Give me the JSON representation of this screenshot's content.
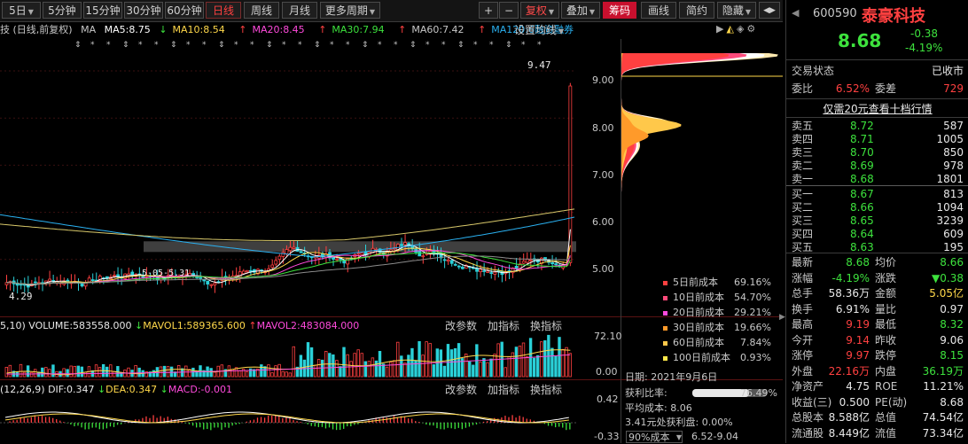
{
  "toolbar": {
    "periods": [
      "5日",
      "5分钟",
      "15分钟",
      "30分钟",
      "60分钟",
      "日线",
      "周线",
      "月线",
      "更多周期"
    ],
    "active_period": "日线",
    "plus": "+",
    "minus": "−",
    "fuquan": "复权",
    "diejia": "叠加",
    "chouma": "筹码",
    "huaxian": "画线",
    "jianyue": "简约",
    "yincang": "隐藏",
    "nav_left": "◀",
    "nav_right": "▶"
  },
  "ma_legend": {
    "prefix": "技 (日线,前复权)",
    "ma": "MA",
    "ma5": "MA5:8.75",
    "ma10": "MA10:8.54",
    "ma20": "MA20:8.45",
    "ma30": "MA30:7.94",
    "ma60": "MA60:7.42",
    "ma120": "MA120:6融资融券",
    "settings": "设置均线"
  },
  "colors": {
    "ma5": "#ffffff",
    "ma10": "#ffd84a",
    "ma20": "#ff4adc",
    "ma30": "#3de23d",
    "ma60": "#8c8c8c",
    "ma120": "#2ab0f0",
    "up": "#ff4040",
    "down": "#2ad0d8"
  },
  "price_axis": [
    "9.00",
    "8.00",
    "7.00",
    "6.00",
    "5.00"
  ],
  "annotations": {
    "high": "9.47",
    "low": "4.29",
    "label_left": "5-05-5.31"
  },
  "volume": {
    "label": "5,10)  VOLUME:583558.000",
    "mavol1": "MAVOL1:589365.600",
    "mavol2": "MAVOL2:483084.000",
    "btn_params": "改参数",
    "btn_add": "加指标",
    "btn_switch": "换指标",
    "axis": [
      "72.10",
      "0.00"
    ]
  },
  "macd": {
    "label": "(12,26,9)  DIF:0.347",
    "dea": "DEA:0.347",
    "macd": "MACD:-0.001",
    "btn_params": "改参数",
    "btn_add": "加指标",
    "btn_switch": "换指标",
    "axis": [
      "0.42",
      "-0.33"
    ]
  },
  "cost": {
    "rows": [
      {
        "label": "5日前成本",
        "pct": "69.16%",
        "color": "#ff4040"
      },
      {
        "label": "10日前成本",
        "pct": "54.70%",
        "color": "#ff4a7a"
      },
      {
        "label": "20日前成本",
        "pct": "29.21%",
        "color": "#ff4adc"
      },
      {
        "label": "30日前成本",
        "pct": "19.66%",
        "color": "#ff9a2a"
      },
      {
        "label": "60日前成本",
        "pct": "7.84%",
        "color": "#ffc84a"
      },
      {
        "label": "100日前成本",
        "pct": "0.93%",
        "color": "#ffe84a"
      }
    ],
    "date": "日期: 2021年9月6日",
    "profit_label": "获利比率:",
    "profit_value": "76.49%",
    "profit_ratio": 0.7649,
    "avg_cost": "平均成本: 8.06",
    "profit_at": "3.41元处获利盘: 0.00%",
    "range_select": "90%成本",
    "range_value": "6.52-9.04"
  },
  "quote": {
    "code": "600590",
    "name": "泰豪科技",
    "price": "8.68",
    "change": "-0.38",
    "change_pct": "-4.19%",
    "status_label": "交易状态",
    "status_value": "已收市",
    "weibi_label": "委比",
    "weibi_value": "6.52%",
    "weicha_label": "委差",
    "weicha_value": "729",
    "level10_link": "仅需20元查看十档行情",
    "asks": [
      {
        "label": "卖五",
        "price": "8.72",
        "vol": "587"
      },
      {
        "label": "卖四",
        "price": "8.71",
        "vol": "1005"
      },
      {
        "label": "卖三",
        "price": "8.70",
        "vol": "850"
      },
      {
        "label": "卖二",
        "price": "8.69",
        "vol": "978"
      },
      {
        "label": "卖一",
        "price": "8.68",
        "vol": "1801"
      }
    ],
    "bids": [
      {
        "label": "买一",
        "price": "8.67",
        "vol": "813"
      },
      {
        "label": "买二",
        "price": "8.66",
        "vol": "1094"
      },
      {
        "label": "买三",
        "price": "8.65",
        "vol": "3239"
      },
      {
        "label": "买四",
        "price": "8.64",
        "vol": "609"
      },
      {
        "label": "买五",
        "price": "8.63",
        "vol": "195"
      }
    ],
    "stats": [
      {
        "l1": "最新",
        "v1": "8.68",
        "c1": "dn",
        "l2": "均价",
        "v2": "8.66",
        "c2": "dn"
      },
      {
        "l1": "涨幅",
        "v1": "-4.19%",
        "c1": "dn",
        "l2": "涨跌",
        "v2": "▼0.38",
        "c2": "dn"
      },
      {
        "l1": "总手",
        "v1": "58.36万",
        "c1": "wh",
        "l2": "金额",
        "v2": "5.05亿",
        "c2": "yl"
      },
      {
        "l1": "换手",
        "v1": "6.91%",
        "c1": "wh",
        "l2": "量比",
        "v2": "0.97",
        "c2": "wh"
      },
      {
        "l1": "最高",
        "v1": "9.19",
        "c1": "up",
        "l2": "最低",
        "v2": "8.32",
        "c2": "dn"
      },
      {
        "l1": "今开",
        "v1": "9.14",
        "c1": "up",
        "l2": "昨收",
        "v2": "9.06",
        "c2": "wh"
      },
      {
        "l1": "涨停",
        "v1": "9.97",
        "c1": "up",
        "l2": "跌停",
        "v2": "8.15",
        "c2": "dn"
      },
      {
        "l1": "外盘",
        "v1": "22.16万",
        "c1": "up",
        "l2": "内盘",
        "v2": "36.19万",
        "c2": "dn"
      },
      {
        "l1": "净资产",
        "v1": "4.75",
        "c1": "wh",
        "l2": "ROE",
        "v2": "11.21%",
        "c2": "wh"
      },
      {
        "l1": "收益(三)",
        "v1": "0.500",
        "c1": "wh",
        "l2": "PE(动)",
        "v2": "8.68",
        "c2": "wh"
      },
      {
        "l1": "总股本",
        "v1": "8.588亿",
        "c1": "wh",
        "l2": "总值",
        "v2": "74.54亿",
        "c2": "wh"
      },
      {
        "l1": "流通股",
        "v1": "8.449亿",
        "c1": "wh",
        "l2": "流值",
        "v2": "73.34亿",
        "c2": "wh"
      }
    ]
  }
}
